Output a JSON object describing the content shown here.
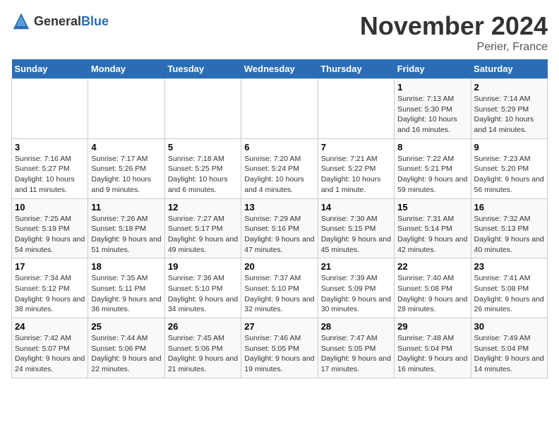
{
  "header": {
    "logo_general": "General",
    "logo_blue": "Blue",
    "month_title": "November 2024",
    "location": "Perier, France"
  },
  "days_of_week": [
    "Sunday",
    "Monday",
    "Tuesday",
    "Wednesday",
    "Thursday",
    "Friday",
    "Saturday"
  ],
  "weeks": [
    [
      {
        "day": "",
        "info": ""
      },
      {
        "day": "",
        "info": ""
      },
      {
        "day": "",
        "info": ""
      },
      {
        "day": "",
        "info": ""
      },
      {
        "day": "",
        "info": ""
      },
      {
        "day": "1",
        "info": "Sunrise: 7:13 AM\nSunset: 5:30 PM\nDaylight: 10 hours and 16 minutes."
      },
      {
        "day": "2",
        "info": "Sunrise: 7:14 AM\nSunset: 5:29 PM\nDaylight: 10 hours and 14 minutes."
      }
    ],
    [
      {
        "day": "3",
        "info": "Sunrise: 7:16 AM\nSunset: 5:27 PM\nDaylight: 10 hours and 11 minutes."
      },
      {
        "day": "4",
        "info": "Sunrise: 7:17 AM\nSunset: 5:26 PM\nDaylight: 10 hours and 9 minutes."
      },
      {
        "day": "5",
        "info": "Sunrise: 7:18 AM\nSunset: 5:25 PM\nDaylight: 10 hours and 6 minutes."
      },
      {
        "day": "6",
        "info": "Sunrise: 7:20 AM\nSunset: 5:24 PM\nDaylight: 10 hours and 4 minutes."
      },
      {
        "day": "7",
        "info": "Sunrise: 7:21 AM\nSunset: 5:22 PM\nDaylight: 10 hours and 1 minute."
      },
      {
        "day": "8",
        "info": "Sunrise: 7:22 AM\nSunset: 5:21 PM\nDaylight: 9 hours and 59 minutes."
      },
      {
        "day": "9",
        "info": "Sunrise: 7:23 AM\nSunset: 5:20 PM\nDaylight: 9 hours and 56 minutes."
      }
    ],
    [
      {
        "day": "10",
        "info": "Sunrise: 7:25 AM\nSunset: 5:19 PM\nDaylight: 9 hours and 54 minutes."
      },
      {
        "day": "11",
        "info": "Sunrise: 7:26 AM\nSunset: 5:18 PM\nDaylight: 9 hours and 51 minutes."
      },
      {
        "day": "12",
        "info": "Sunrise: 7:27 AM\nSunset: 5:17 PM\nDaylight: 9 hours and 49 minutes."
      },
      {
        "day": "13",
        "info": "Sunrise: 7:29 AM\nSunset: 5:16 PM\nDaylight: 9 hours and 47 minutes."
      },
      {
        "day": "14",
        "info": "Sunrise: 7:30 AM\nSunset: 5:15 PM\nDaylight: 9 hours and 45 minutes."
      },
      {
        "day": "15",
        "info": "Sunrise: 7:31 AM\nSunset: 5:14 PM\nDaylight: 9 hours and 42 minutes."
      },
      {
        "day": "16",
        "info": "Sunrise: 7:32 AM\nSunset: 5:13 PM\nDaylight: 9 hours and 40 minutes."
      }
    ],
    [
      {
        "day": "17",
        "info": "Sunrise: 7:34 AM\nSunset: 5:12 PM\nDaylight: 9 hours and 38 minutes."
      },
      {
        "day": "18",
        "info": "Sunrise: 7:35 AM\nSunset: 5:11 PM\nDaylight: 9 hours and 36 minutes."
      },
      {
        "day": "19",
        "info": "Sunrise: 7:36 AM\nSunset: 5:10 PM\nDaylight: 9 hours and 34 minutes."
      },
      {
        "day": "20",
        "info": "Sunrise: 7:37 AM\nSunset: 5:10 PM\nDaylight: 9 hours and 32 minutes."
      },
      {
        "day": "21",
        "info": "Sunrise: 7:39 AM\nSunset: 5:09 PM\nDaylight: 9 hours and 30 minutes."
      },
      {
        "day": "22",
        "info": "Sunrise: 7:40 AM\nSunset: 5:08 PM\nDaylight: 9 hours and 28 minutes."
      },
      {
        "day": "23",
        "info": "Sunrise: 7:41 AM\nSunset: 5:08 PM\nDaylight: 9 hours and 26 minutes."
      }
    ],
    [
      {
        "day": "24",
        "info": "Sunrise: 7:42 AM\nSunset: 5:07 PM\nDaylight: 9 hours and 24 minutes."
      },
      {
        "day": "25",
        "info": "Sunrise: 7:44 AM\nSunset: 5:06 PM\nDaylight: 9 hours and 22 minutes."
      },
      {
        "day": "26",
        "info": "Sunrise: 7:45 AM\nSunset: 5:06 PM\nDaylight: 9 hours and 21 minutes."
      },
      {
        "day": "27",
        "info": "Sunrise: 7:46 AM\nSunset: 5:05 PM\nDaylight: 9 hours and 19 minutes."
      },
      {
        "day": "28",
        "info": "Sunrise: 7:47 AM\nSunset: 5:05 PM\nDaylight: 9 hours and 17 minutes."
      },
      {
        "day": "29",
        "info": "Sunrise: 7:48 AM\nSunset: 5:04 PM\nDaylight: 9 hours and 16 minutes."
      },
      {
        "day": "30",
        "info": "Sunrise: 7:49 AM\nSunset: 5:04 PM\nDaylight: 9 hours and 14 minutes."
      }
    ]
  ]
}
